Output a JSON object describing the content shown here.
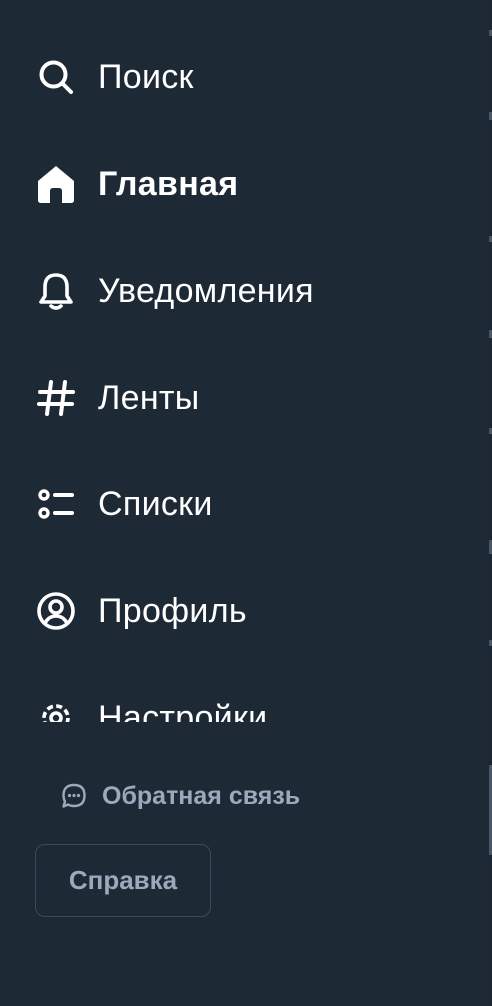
{
  "nav": {
    "items": [
      {
        "label": "Поиск",
        "icon": "search-icon"
      },
      {
        "label": "Главная",
        "icon": "home-icon",
        "active": true
      },
      {
        "label": "Уведомления",
        "icon": "bell-icon"
      },
      {
        "label": "Ленты",
        "icon": "hashtag-icon"
      },
      {
        "label": "Списки",
        "icon": "list-icon"
      },
      {
        "label": "Профиль",
        "icon": "user-circle-icon"
      },
      {
        "label": "Настройки",
        "icon": "gear-icon"
      }
    ]
  },
  "footer": {
    "feedback_label": "Обратная связь",
    "feedback_icon": "chat-bubble-icon",
    "help_label": "Справка"
  },
  "colors": {
    "background": "#1e2936",
    "text": "#ffffff",
    "muted_text": "#9aa9bb",
    "button_border": "#3c4a5b"
  }
}
